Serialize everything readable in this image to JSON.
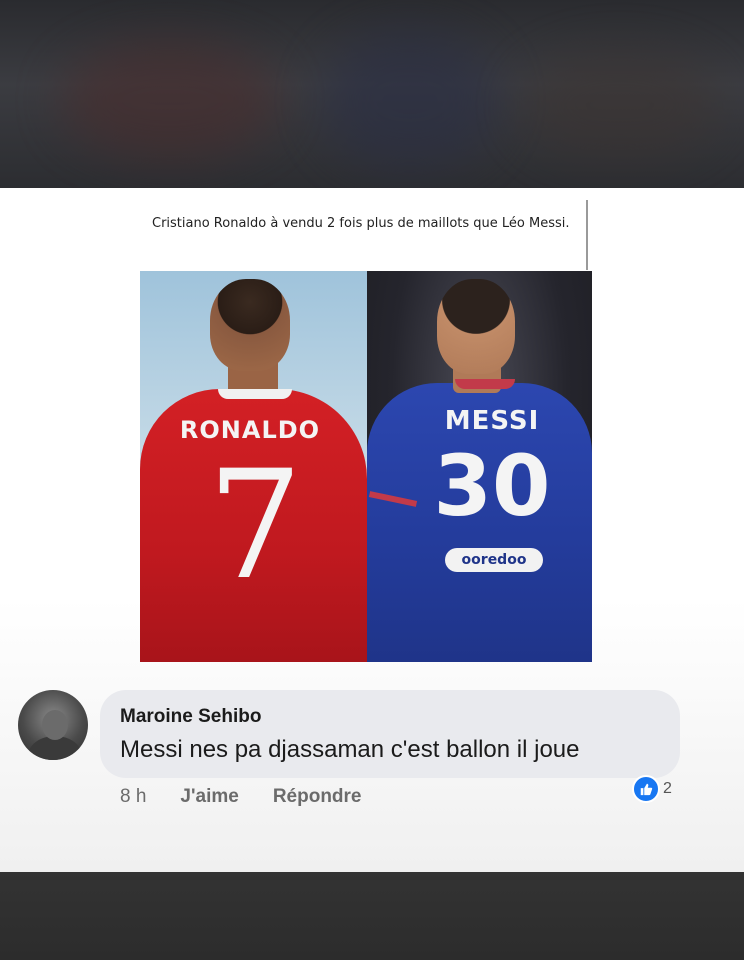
{
  "post": {
    "caption": "Cristiano Ronaldo à vendu 2 fois plus de maillots que Léo Messi.",
    "image": {
      "left_player": {
        "shirt_name": "RONALDO",
        "shirt_number": "7"
      },
      "right_player": {
        "shirt_name": "MESSI",
        "shirt_number": "30",
        "sponsor": "ooredoo"
      }
    }
  },
  "comment": {
    "author": "Maroine Sehibo",
    "text": "Messi nes pa djassaman c'est ballon il joue",
    "time": "8 h",
    "like_label": "J'aime",
    "reply_label": "Répondre",
    "reaction_icon": "thumbs-up-icon",
    "reaction_count": "2"
  },
  "colors": {
    "like_blue": "#1877f2",
    "bubble_bg": "#e9eaee",
    "ronaldo_red": "#d32025",
    "messi_blue": "#2c47b0"
  }
}
